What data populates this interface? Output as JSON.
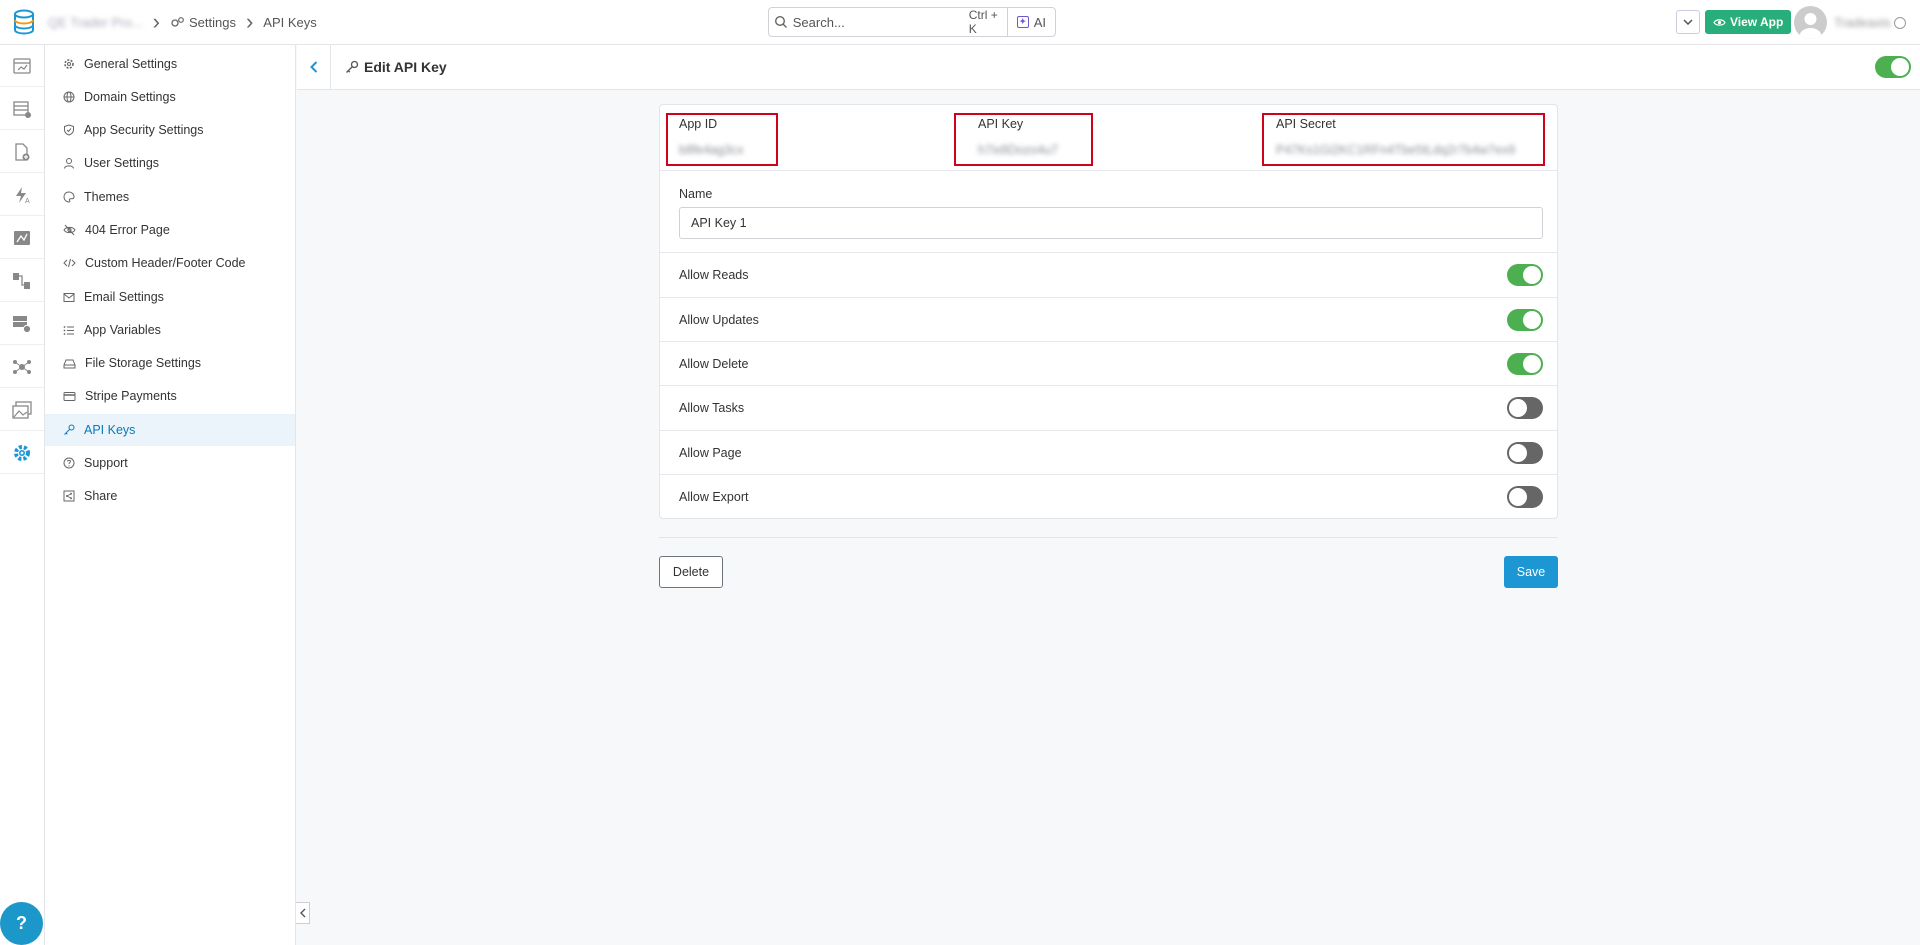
{
  "breadcrumb": {
    "app_name": "QE Trader Pro...",
    "settings": "Settings",
    "current": "API Keys"
  },
  "search": {
    "placeholder": "Search...",
    "shortcut": "Ctrl + K",
    "ai_label": "AI"
  },
  "topbar": {
    "view_app_label": "View App",
    "username": "Tradeaxis"
  },
  "icons": {
    "rail": [
      "dashboard-icon",
      "table-icon",
      "document-add-icon",
      "lightning-icon",
      "chart-icon",
      "workflow-icon",
      "database-add-icon",
      "network-icon",
      "gallery-icon",
      "gear-icon"
    ],
    "help": "?"
  },
  "sidebar": {
    "items": [
      {
        "label": "General Settings",
        "icon": "gear-icon"
      },
      {
        "label": "Domain Settings",
        "icon": "globe-icon"
      },
      {
        "label": "App Security Settings",
        "icon": "shield-icon"
      },
      {
        "label": "User Settings",
        "icon": "user-icon"
      },
      {
        "label": "Themes",
        "icon": "palette-icon"
      },
      {
        "label": "404 Error Page",
        "icon": "eye-off-icon"
      },
      {
        "label": "Custom Header/Footer Code",
        "icon": "code-icon"
      },
      {
        "label": "Email Settings",
        "icon": "mail-icon"
      },
      {
        "label": "App Variables",
        "icon": "list-icon"
      },
      {
        "label": "File Storage Settings",
        "icon": "drive-icon"
      },
      {
        "label": "Stripe Payments",
        "icon": "card-icon"
      },
      {
        "label": "API Keys",
        "icon": "key-icon",
        "active": true
      },
      {
        "label": "Support",
        "icon": "help-circle-icon"
      },
      {
        "label": "Share",
        "icon": "share-icon"
      }
    ]
  },
  "header": {
    "title": "Edit API Key",
    "enabled": true
  },
  "credentials": {
    "app_id_label": "App ID",
    "app_id_value": "b8fe4ag3cx",
    "api_key_label": "API Key",
    "api_key_value": "h7ix8Dozo4u7",
    "api_secret_label": "API Secret",
    "api_secret_value": "P47Ks1Gi2KC1RFn4Tbe5tLdq2r7b4w7ex9"
  },
  "name_field": {
    "label": "Name",
    "value": "API Key 1"
  },
  "permissions": [
    {
      "label": "Allow Reads",
      "enabled": true
    },
    {
      "label": "Allow Updates",
      "enabled": true
    },
    {
      "label": "Allow Delete",
      "enabled": true
    },
    {
      "label": "Allow Tasks",
      "enabled": false
    },
    {
      "label": "Allow Page",
      "enabled": false
    },
    {
      "label": "Allow Export",
      "enabled": false
    }
  ],
  "actions": {
    "delete_label": "Delete",
    "save_label": "Save"
  },
  "colors": {
    "accent": "#1c97d4",
    "toggle_on": "#4caf50",
    "toggle_off": "#666666",
    "view_app": "#27ae7a",
    "highlight_border": "#d0021b"
  }
}
